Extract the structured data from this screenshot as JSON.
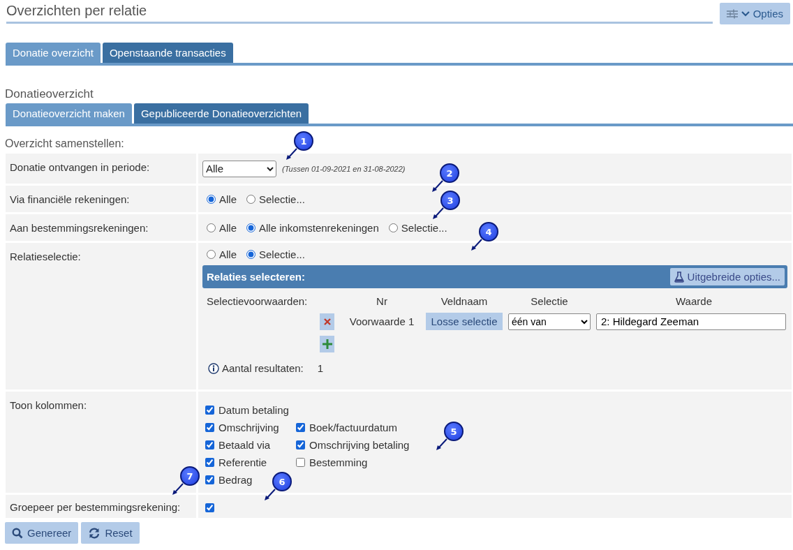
{
  "page_title": "Overzichten per relatie",
  "options_button": "Opties",
  "main_tabs": [
    {
      "label": "Donatie overzicht",
      "selected": true
    },
    {
      "label": "Openstaande transacties",
      "selected": false
    }
  ],
  "section_title": "Donatieoverzicht",
  "sub_tabs": [
    {
      "label": "Donatieoverzicht maken",
      "selected": true
    },
    {
      "label": "Gepubliceerde Donatieoverzichten",
      "selected": false
    }
  ],
  "form_title": "Overzicht samenstellen:",
  "period": {
    "label": "Donatie ontvangen in periode:",
    "value": "Alle",
    "note": "(Tussen 01-09-2021 en 31-08-2022)"
  },
  "financial_accounts": {
    "label": "Via financiële rekeningen:",
    "options": [
      {
        "label": "Alle",
        "selected": true
      },
      {
        "label": "Selectie...",
        "selected": false
      }
    ]
  },
  "destination_accounts": {
    "label": "Aan bestemmingsrekeningen:",
    "options": [
      {
        "label": "Alle",
        "selected": false
      },
      {
        "label": "Alle inkomstenrekeningen",
        "selected": true
      },
      {
        "label": "Selectie...",
        "selected": false
      }
    ]
  },
  "relation_selection": {
    "label": "Relatieselectie:",
    "options": [
      {
        "label": "Alle",
        "selected": false
      },
      {
        "label": "Selectie...",
        "selected": true
      }
    ],
    "panel_title": "Relaties selecteren:",
    "advanced_button": "Uitgebreide opties...",
    "conditions_label": "Selectievoorwaarden:",
    "columns": [
      "Nr",
      "Veldnaam",
      "Selectie",
      "Waarde"
    ],
    "conditions": [
      {
        "nr": "Voorwaarde 1",
        "field": "Losse selectie",
        "selection": "één van",
        "value": "2: Hildegard Zeeman"
      }
    ],
    "results_label": "Aantal resultaten:",
    "results": "1"
  },
  "show_columns": {
    "label": "Toon kolommen:",
    "rows": [
      [
        {
          "label": "Datum betaling",
          "checked": true
        }
      ],
      [
        {
          "label": "Omschrijving",
          "checked": true
        },
        {
          "label": "Boek/factuurdatum",
          "checked": true
        }
      ],
      [
        {
          "label": "Betaald via",
          "checked": true
        },
        {
          "label": "Omschrijving betaling",
          "checked": true
        }
      ],
      [
        {
          "label": "Referentie",
          "checked": true
        },
        {
          "label": "Bestemming",
          "checked": false
        }
      ],
      [
        {
          "label": "Bedrag",
          "checked": true
        }
      ]
    ]
  },
  "group_by": {
    "label": "Groepeer per bestemmingsrekening:",
    "checked": true
  },
  "buttons": [
    {
      "label": "Genereer",
      "kind": "search"
    },
    {
      "label": "Reset",
      "kind": "refresh"
    }
  ],
  "markers": [
    "1",
    "2",
    "3",
    "4",
    "5",
    "6",
    "7"
  ]
}
